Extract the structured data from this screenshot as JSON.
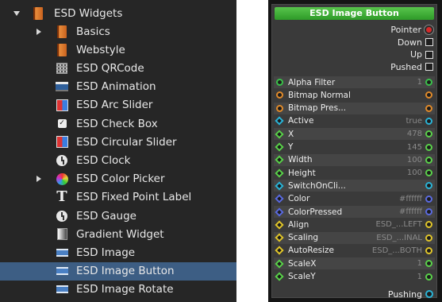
{
  "tree": {
    "root": {
      "label": "ESD Widgets",
      "icon": "book-icon"
    },
    "items": [
      {
        "label": "Basics",
        "icon": "book-icon",
        "expandable": true
      },
      {
        "label": "Webstyle",
        "icon": "book-icon",
        "expandable": false
      },
      {
        "label": "ESD QRCode",
        "icon": "qrcode-icon"
      },
      {
        "label": "ESD Animation",
        "icon": "animation-icon"
      },
      {
        "label": "ESD Arc Slider",
        "icon": "arc-slider-icon"
      },
      {
        "label": "ESD Check Box",
        "icon": "checkbox-icon"
      },
      {
        "label": "ESD Circular Slider",
        "icon": "circular-slider-icon"
      },
      {
        "label": "ESD Clock",
        "icon": "clock-icon"
      },
      {
        "label": "ESD Color Picker",
        "icon": "color-picker-icon",
        "expandable": true
      },
      {
        "label": "ESD Fixed Point Label",
        "icon": "text-icon"
      },
      {
        "label": "ESD Gauge",
        "icon": "gauge-icon"
      },
      {
        "label": "Gradient Widget",
        "icon": "gradient-icon"
      },
      {
        "label": "ESD Image",
        "icon": "image-icon"
      },
      {
        "label": "ESD Image Button",
        "icon": "image-button-icon",
        "selected": true
      },
      {
        "label": "ESD Image Rotate",
        "icon": "image-rotate-icon"
      }
    ],
    "selected_color": "#3d5e84"
  },
  "node": {
    "title": "ESD Image Button",
    "title_color": "#3fae36",
    "outputs": [
      {
        "label": "Pointer",
        "pin": "dot"
      },
      {
        "label": "Down",
        "pin": "box"
      },
      {
        "label": "Up",
        "pin": "box"
      },
      {
        "label": "Pushed",
        "pin": "box"
      }
    ],
    "properties": [
      {
        "name": "Alpha Filter",
        "value": "1",
        "pin": "circle",
        "color": "green"
      },
      {
        "name": "Bitmap Normal",
        "value": "",
        "pin": "circle",
        "color": "orange"
      },
      {
        "name": "Bitmap Pres...",
        "value": "",
        "pin": "circle",
        "color": "orange"
      },
      {
        "name": "Active",
        "value": "true",
        "pin": "diamond",
        "color": "cyan"
      },
      {
        "name": "X",
        "value": "478",
        "pin": "diamond",
        "color": "lime"
      },
      {
        "name": "Y",
        "value": "145",
        "pin": "diamond",
        "color": "lime"
      },
      {
        "name": "Width",
        "value": "100",
        "pin": "diamond",
        "color": "lime"
      },
      {
        "name": "Height",
        "value": "100",
        "pin": "diamond",
        "color": "lime"
      },
      {
        "name": "SwitchOnCli...",
        "value": "",
        "pin": "diamond",
        "color": "cyan"
      },
      {
        "name": "Color",
        "value": "#ffffff",
        "pin": "diamond",
        "color": "blue"
      },
      {
        "name": "ColorPressed",
        "value": "#ffffff",
        "pin": "diamond",
        "color": "blue"
      },
      {
        "name": "Align",
        "value": "ESD_...LEFT",
        "pin": "diamond",
        "color": "yellow"
      },
      {
        "name": "Scaling",
        "value": "ESD_...INAL",
        "pin": "diamond",
        "color": "yellow"
      },
      {
        "name": "AutoResize",
        "value": "ESD_...BOTH",
        "pin": "diamond",
        "color": "yellow"
      },
      {
        "name": "ScaleX",
        "value": "1",
        "pin": "diamond",
        "color": "lime"
      },
      {
        "name": "ScaleY",
        "value": "1",
        "pin": "diamond",
        "color": "lime"
      }
    ],
    "footer_output": {
      "label": "Pushing",
      "pin": "circle",
      "color": "cyan"
    }
  }
}
